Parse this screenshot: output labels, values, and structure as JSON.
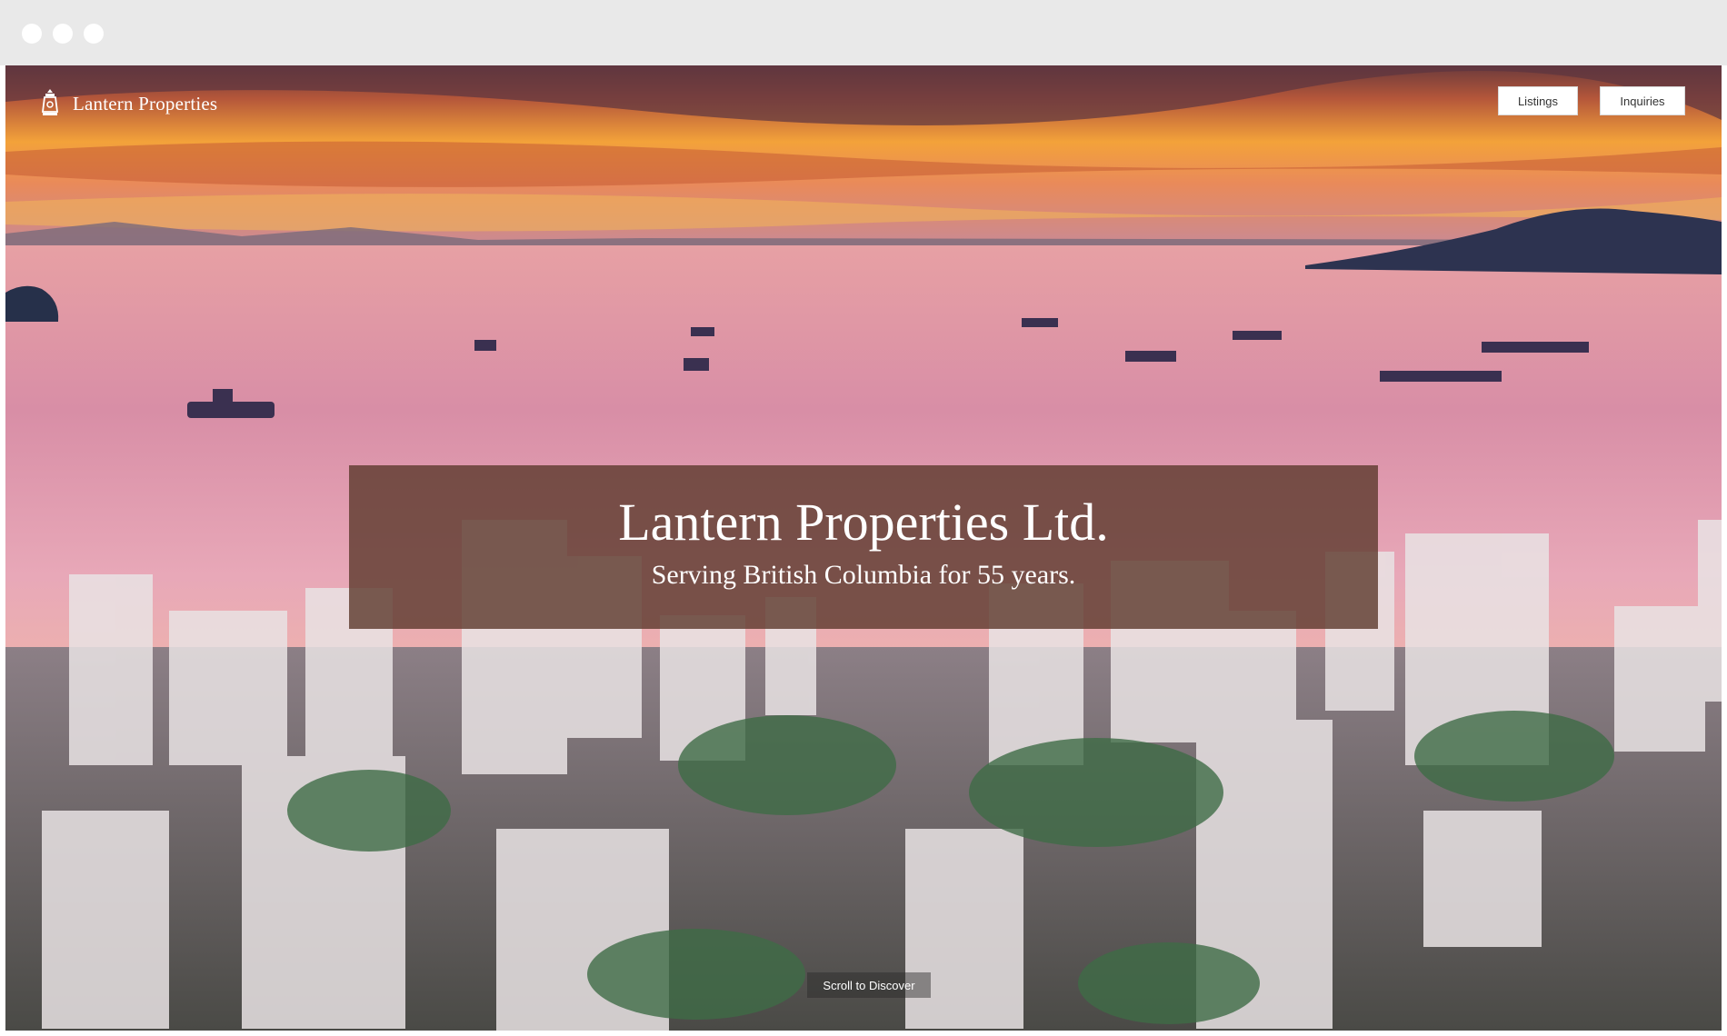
{
  "window": {
    "controls": [
      "close",
      "minimize",
      "maximize"
    ]
  },
  "header": {
    "brand_name": "Lantern Properties",
    "brand_icon": "lantern-icon",
    "nav": [
      {
        "label": "Listings"
      },
      {
        "label": "Inquiries"
      }
    ]
  },
  "hero": {
    "image": "sunset-over-bay-with-city-skyline",
    "title": "Lantern Properties Ltd.",
    "subtitle": "Serving British Columbia for 55 years.",
    "scroll_cue": "Scroll to Discover"
  },
  "colors": {
    "caption_bg": "#5f3c30",
    "button_bg": "#ffffff",
    "sky_orange": "#f2a33c",
    "water_pink": "#d58fa6"
  }
}
